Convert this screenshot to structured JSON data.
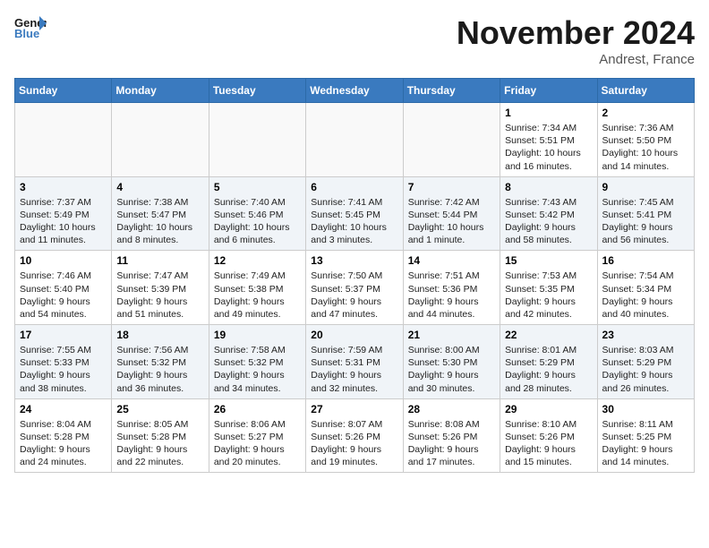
{
  "header": {
    "logo_line1": "General",
    "logo_line2": "Blue",
    "month": "November 2024",
    "location": "Andrest, France"
  },
  "days_of_week": [
    "Sunday",
    "Monday",
    "Tuesday",
    "Wednesday",
    "Thursday",
    "Friday",
    "Saturday"
  ],
  "weeks": [
    {
      "alt": false,
      "days": [
        {
          "num": "",
          "info": ""
        },
        {
          "num": "",
          "info": ""
        },
        {
          "num": "",
          "info": ""
        },
        {
          "num": "",
          "info": ""
        },
        {
          "num": "",
          "info": ""
        },
        {
          "num": "1",
          "info": "Sunrise: 7:34 AM\nSunset: 5:51 PM\nDaylight: 10 hours and 16 minutes."
        },
        {
          "num": "2",
          "info": "Sunrise: 7:36 AM\nSunset: 5:50 PM\nDaylight: 10 hours and 14 minutes."
        }
      ]
    },
    {
      "alt": true,
      "days": [
        {
          "num": "3",
          "info": "Sunrise: 7:37 AM\nSunset: 5:49 PM\nDaylight: 10 hours and 11 minutes."
        },
        {
          "num": "4",
          "info": "Sunrise: 7:38 AM\nSunset: 5:47 PM\nDaylight: 10 hours and 8 minutes."
        },
        {
          "num": "5",
          "info": "Sunrise: 7:40 AM\nSunset: 5:46 PM\nDaylight: 10 hours and 6 minutes."
        },
        {
          "num": "6",
          "info": "Sunrise: 7:41 AM\nSunset: 5:45 PM\nDaylight: 10 hours and 3 minutes."
        },
        {
          "num": "7",
          "info": "Sunrise: 7:42 AM\nSunset: 5:44 PM\nDaylight: 10 hours and 1 minute."
        },
        {
          "num": "8",
          "info": "Sunrise: 7:43 AM\nSunset: 5:42 PM\nDaylight: 9 hours and 58 minutes."
        },
        {
          "num": "9",
          "info": "Sunrise: 7:45 AM\nSunset: 5:41 PM\nDaylight: 9 hours and 56 minutes."
        }
      ]
    },
    {
      "alt": false,
      "days": [
        {
          "num": "10",
          "info": "Sunrise: 7:46 AM\nSunset: 5:40 PM\nDaylight: 9 hours and 54 minutes."
        },
        {
          "num": "11",
          "info": "Sunrise: 7:47 AM\nSunset: 5:39 PM\nDaylight: 9 hours and 51 minutes."
        },
        {
          "num": "12",
          "info": "Sunrise: 7:49 AM\nSunset: 5:38 PM\nDaylight: 9 hours and 49 minutes."
        },
        {
          "num": "13",
          "info": "Sunrise: 7:50 AM\nSunset: 5:37 PM\nDaylight: 9 hours and 47 minutes."
        },
        {
          "num": "14",
          "info": "Sunrise: 7:51 AM\nSunset: 5:36 PM\nDaylight: 9 hours and 44 minutes."
        },
        {
          "num": "15",
          "info": "Sunrise: 7:53 AM\nSunset: 5:35 PM\nDaylight: 9 hours and 42 minutes."
        },
        {
          "num": "16",
          "info": "Sunrise: 7:54 AM\nSunset: 5:34 PM\nDaylight: 9 hours and 40 minutes."
        }
      ]
    },
    {
      "alt": true,
      "days": [
        {
          "num": "17",
          "info": "Sunrise: 7:55 AM\nSunset: 5:33 PM\nDaylight: 9 hours and 38 minutes."
        },
        {
          "num": "18",
          "info": "Sunrise: 7:56 AM\nSunset: 5:32 PM\nDaylight: 9 hours and 36 minutes."
        },
        {
          "num": "19",
          "info": "Sunrise: 7:58 AM\nSunset: 5:32 PM\nDaylight: 9 hours and 34 minutes."
        },
        {
          "num": "20",
          "info": "Sunrise: 7:59 AM\nSunset: 5:31 PM\nDaylight: 9 hours and 32 minutes."
        },
        {
          "num": "21",
          "info": "Sunrise: 8:00 AM\nSunset: 5:30 PM\nDaylight: 9 hours and 30 minutes."
        },
        {
          "num": "22",
          "info": "Sunrise: 8:01 AM\nSunset: 5:29 PM\nDaylight: 9 hours and 28 minutes."
        },
        {
          "num": "23",
          "info": "Sunrise: 8:03 AM\nSunset: 5:29 PM\nDaylight: 9 hours and 26 minutes."
        }
      ]
    },
    {
      "alt": false,
      "days": [
        {
          "num": "24",
          "info": "Sunrise: 8:04 AM\nSunset: 5:28 PM\nDaylight: 9 hours and 24 minutes."
        },
        {
          "num": "25",
          "info": "Sunrise: 8:05 AM\nSunset: 5:28 PM\nDaylight: 9 hours and 22 minutes."
        },
        {
          "num": "26",
          "info": "Sunrise: 8:06 AM\nSunset: 5:27 PM\nDaylight: 9 hours and 20 minutes."
        },
        {
          "num": "27",
          "info": "Sunrise: 8:07 AM\nSunset: 5:26 PM\nDaylight: 9 hours and 19 minutes."
        },
        {
          "num": "28",
          "info": "Sunrise: 8:08 AM\nSunset: 5:26 PM\nDaylight: 9 hours and 17 minutes."
        },
        {
          "num": "29",
          "info": "Sunrise: 8:10 AM\nSunset: 5:26 PM\nDaylight: 9 hours and 15 minutes."
        },
        {
          "num": "30",
          "info": "Sunrise: 8:11 AM\nSunset: 5:25 PM\nDaylight: 9 hours and 14 minutes."
        }
      ]
    }
  ]
}
